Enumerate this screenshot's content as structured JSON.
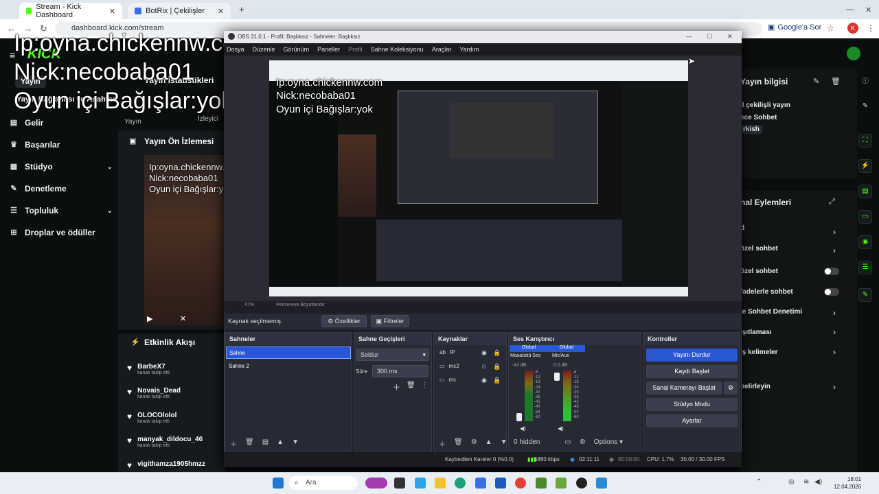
{
  "browser": {
    "tabs": [
      {
        "label": "Stream - Kick Dashboard",
        "close": "✕"
      },
      {
        "label": "BotRix | Çekilişler",
        "close": "✕"
      }
    ],
    "new_tab": "+",
    "url": "dashboard.kick.com/stream",
    "translate": "Google'a Sor",
    "profile_initial": "K"
  },
  "overlay": {
    "line1": "Ip:oyna.chickennw.com",
    "line2": "Nick:necobaba01",
    "line3": "Oyun içi Bağışlar:yok",
    "logo": "KICK"
  },
  "sidebar": {
    "items": [
      {
        "label": "Gelir"
      },
      {
        "label": "Başarılar"
      },
      {
        "label": "Stüdyo"
      },
      {
        "label": "Denetleme"
      },
      {
        "label": "Topluluk"
      },
      {
        "label": "Droplar ve ödüller"
      }
    ],
    "header_partial": "Yayın Bağlantısı ve Anahtar"
  },
  "stats": {
    "title": "Yayın İstatistikleri",
    "tab_yayin": "Yayın",
    "tab_izleyici": "İzleyici"
  },
  "preview": {
    "title": "Yayın Ön İzlemesi"
  },
  "activity": {
    "title": "Etkinlik Akışı",
    "items": [
      {
        "name": "BarbeX7",
        "sub": "kanalı takip etti"
      },
      {
        "name": "Novais_Dead",
        "sub": "kanalı takip etti"
      },
      {
        "name": "OLOCOlolol",
        "sub": "kanalı takip etti"
      },
      {
        "name": "manyak_dildocu_46",
        "sub": "kanalı takip etti"
      },
      {
        "name": "vigithamza1905hmzz",
        "sub": ""
      }
    ]
  },
  "right_panel": {
    "info_title": "Yayın bilgisi",
    "info_lines": [
      "il çekilişli yayın",
      "ece Sohbet",
      "rkish"
    ],
    "actions_title": "nal Eylemleri",
    "actions": [
      "d",
      "özel sohbet",
      "özel sohbet",
      "fadelerle sohbet",
      "le Sohbet Denetimi",
      "ışıtlaması",
      "ış kelimeler",
      "belirleyin"
    ]
  },
  "obs": {
    "title": "OBS 31.0.1 - Profil: Başlıksız - Sahneler: Başlıksız",
    "menu": [
      "Dosya",
      "Düzenle",
      "Görünüm",
      "Paneller",
      "Profil",
      "Sahne Koleksiyonu",
      "Araçlar",
      "Yardım"
    ],
    "zoom": "47%",
    "fit": "Pencereye Boyutlandır",
    "no_source": "Kaynak seçilmemiş",
    "properties": "Özellikler",
    "filters": "Filtreler",
    "docks": {
      "scenes": {
        "title": "Sahneler",
        "items": [
          "Sahne",
          "Sahne 2"
        ]
      },
      "transitions": {
        "title": "Sahne Geçişleri",
        "type": "Soldur",
        "duration_label": "Süre",
        "duration": "300 ms"
      },
      "sources": {
        "title": "Kaynaklar",
        "items": [
          "IP",
          "mc2",
          "mc"
        ]
      },
      "mixer": {
        "title": "Ses Karıştırıcı",
        "channels": [
          {
            "badge": "Global",
            "name": "Masaüstü Ses",
            "db": "-inf dB"
          },
          {
            "badge": "Global",
            "name": "Mic/Aux",
            "db": "0.0 dB"
          }
        ],
        "scale": [
          "-6",
          "-12",
          "-18",
          "-24",
          "-30",
          "-36",
          "-42",
          "-48",
          "-54",
          "-60"
        ],
        "hidden": "0 hidden",
        "options": "Options"
      },
      "controls": {
        "title": "Kontroller",
        "buttons": [
          "Yayını Durdur",
          "Kaydı Başlat",
          "Sanal Kamerayı Başlat",
          "Stüdyo Modu",
          "Ayarlar"
        ]
      }
    },
    "status": {
      "dropped": "Kaybedilen Kareler 0 (%0.0)",
      "bitrate": "5880 kbps",
      "stream_time": "02:11:11",
      "rec_time": "00:00:00",
      "cpu": "CPU: 1.7%",
      "fps": "30.00 / 30.00 FPS"
    }
  },
  "taskbar": {
    "search": "Ara",
    "time": "18:01",
    "date": "12.04.2026"
  },
  "colors": {
    "kick_green": "#53fc18",
    "obs_blue": "#2a57d6",
    "obs_bg": "#1e1f26"
  }
}
